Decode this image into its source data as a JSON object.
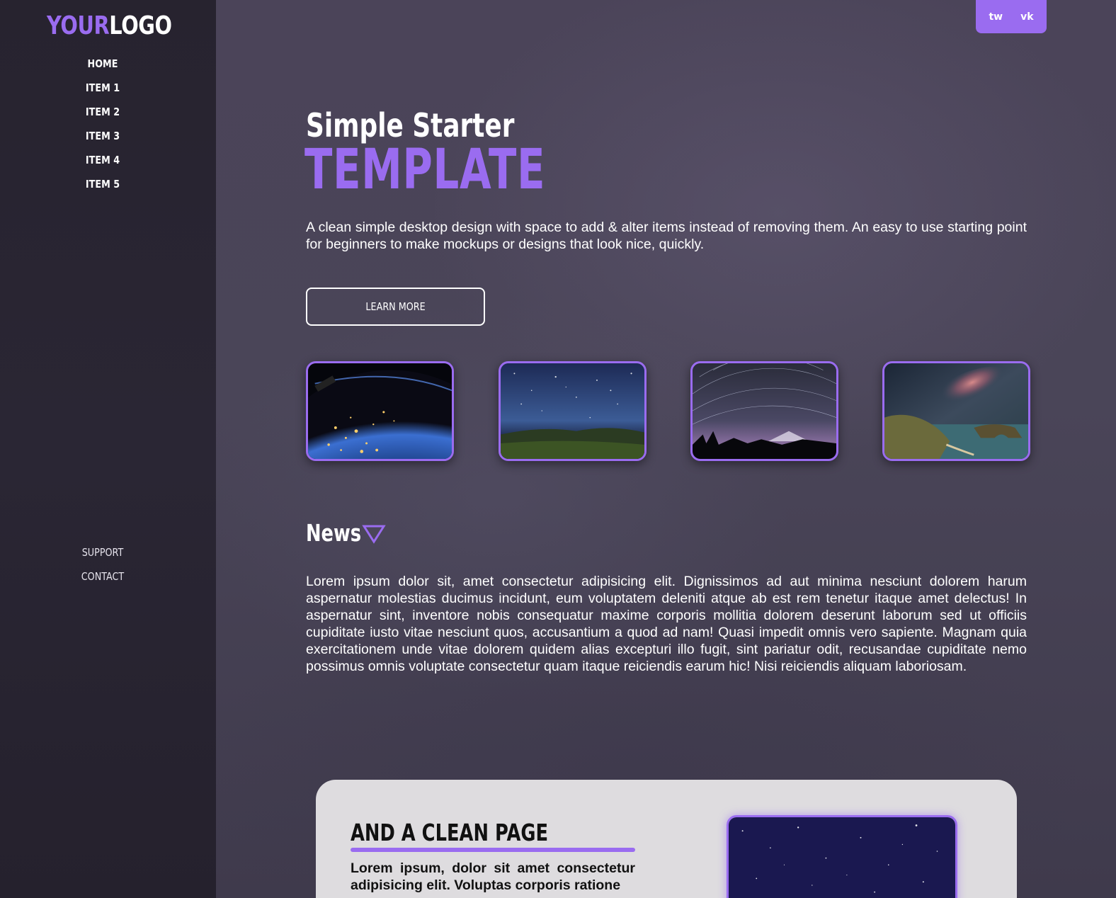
{
  "brand": {
    "logo_accent": "YOUR",
    "logo_plain": "LOGO",
    "accent_color": "#9a6cf0"
  },
  "sidebar": {
    "nav": [
      {
        "label": "HOME"
      },
      {
        "label": "ITEM 1"
      },
      {
        "label": "ITEM 2"
      },
      {
        "label": "ITEM 3"
      },
      {
        "label": "ITEM 4"
      },
      {
        "label": "ITEM 5"
      }
    ],
    "footer_nav": [
      {
        "label": "SUPPORT"
      },
      {
        "label": "CONTACT"
      }
    ]
  },
  "social": {
    "tw": "tw",
    "vk": "vk"
  },
  "hero": {
    "subtitle": "Simple Starter",
    "title": "TEMPLATE",
    "description": "A clean simple desktop design with space to add & alter items instead of removing them. An easy to use starting point for beginners to make mockups or designs that look nice, quickly.",
    "button_label": "LEARN MORE"
  },
  "gallery": [
    {
      "icon": "earth-at-night-image"
    },
    {
      "icon": "starry-sky-image"
    },
    {
      "icon": "star-trails-image"
    },
    {
      "icon": "milky-way-coast-image"
    }
  ],
  "news": {
    "title": "News",
    "body": "Lorem ipsum dolor sit, amet consectetur adipisicing elit. Dignissimos ad aut minima nesciunt dolorem harum aspernatur molestias ducimus incidunt, eum voluptatem deleniti atque ab est rem tenetur itaque amet delectus! In aspernatur sint, inventore nobis consequatur maxime corporis mollitia dolorem deserunt laborum sed ut officiis cupiditate iusto vitae nesciunt quos, accusantium a quod ad nam! Quasi impedit omnis vero sapiente. Magnam quia exercitationem unde vitae dolorem quidem alias excepturi illo fugit, sint pariatur odit, recusandae cupiditate nemo possimus omnis voluptate consectetur quam itaque reiciendis earum hic! Nisi reiciendis aliquam laboriosam."
  },
  "card": {
    "title": "AND A CLEAN PAGE",
    "text": "Lorem ipsum, dolor sit amet consectetur adipisicing elit. Voluptas corporis ratione"
  }
}
